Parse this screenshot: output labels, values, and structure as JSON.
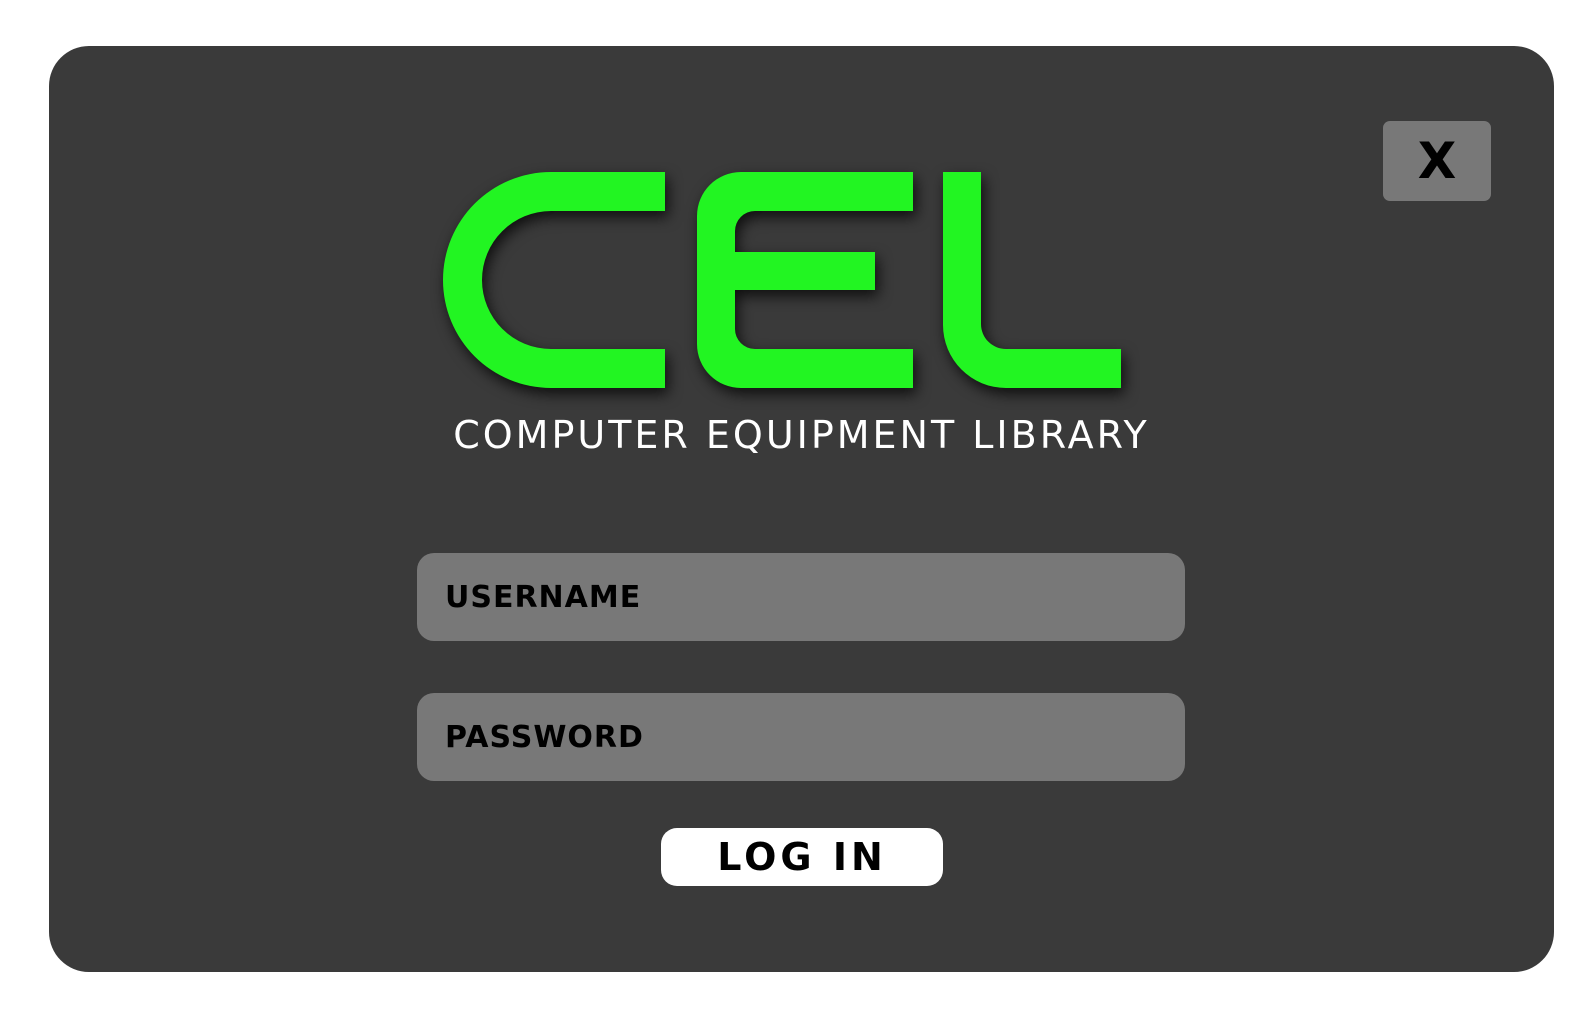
{
  "window": {
    "close_label": "X",
    "background": "#3a3a3a"
  },
  "logo": {
    "text": "CEL",
    "color": "#22f522",
    "tagline": "COMPUTER EQUIPMENT LIBRARY"
  },
  "form": {
    "username_placeholder": "USERNAME",
    "username_value": "",
    "password_placeholder": "PASSWORD",
    "password_value": "",
    "login_label": "LOG IN"
  },
  "colors": {
    "field_bg": "#787878",
    "button_bg": "#ffffff",
    "accent": "#22f522"
  }
}
